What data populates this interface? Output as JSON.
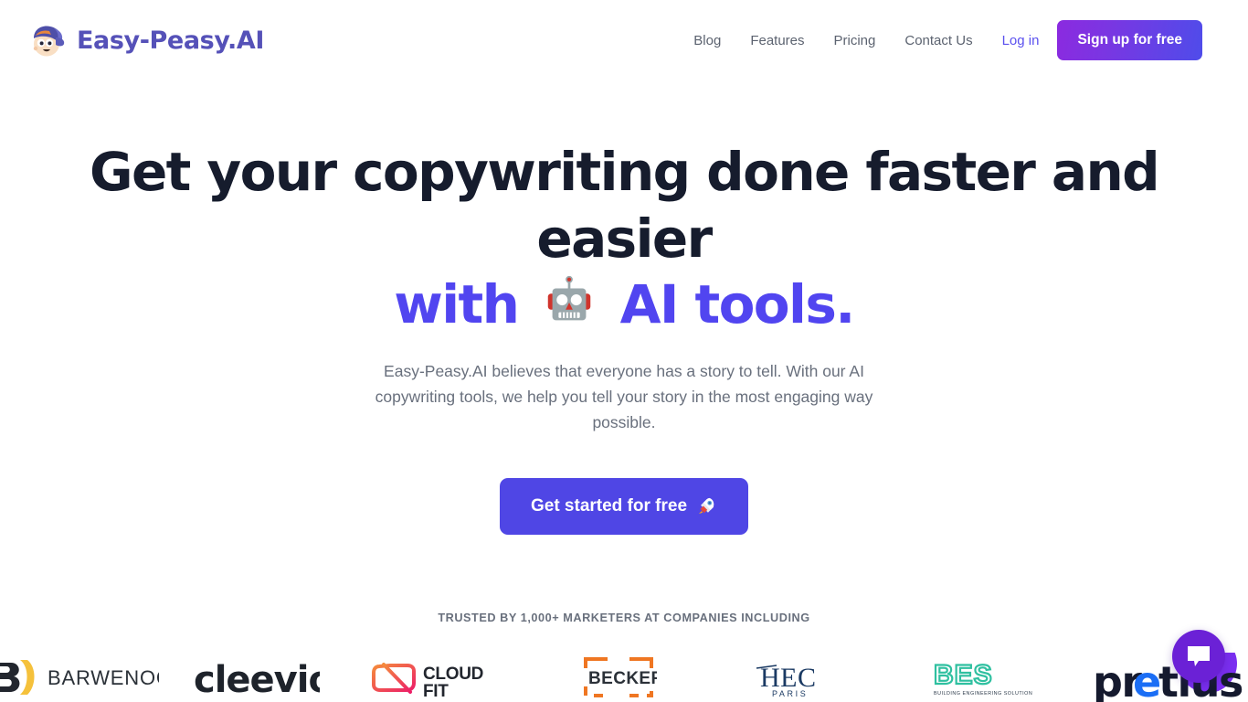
{
  "brand": {
    "name": "Easy-Peasy.AI",
    "logo_icon": "mascot-face-icon",
    "color": "#5551b8"
  },
  "nav": {
    "links": [
      {
        "label": "Blog",
        "name": "nav-link-blog"
      },
      {
        "label": "Features",
        "name": "nav-link-features"
      },
      {
        "label": "Pricing",
        "name": "nav-link-pricing"
      },
      {
        "label": "Contact Us",
        "name": "nav-link-contact-us"
      }
    ],
    "login_label": "Log in",
    "signup_label": "Sign up for free",
    "login_color": "#5b51ef",
    "signup_gradient_from": "#8b2ae0",
    "signup_gradient_to": "#4f4cea"
  },
  "hero": {
    "headline_line1": "Get your copywriting done faster and easier",
    "headline_line2_prefix": "with",
    "headline_emoji": "robot-emoji",
    "headline_line2_suffix": "AI tools.",
    "headline_color": "#161c2d",
    "accent_color": "#5145f0",
    "subheading": "Easy-Peasy.AI believes that everyone has a story to tell. With our AI copywriting tools, we help you tell your story in the most engaging way possible.",
    "cta_label": "Get started for free",
    "cta_emoji": "rocket-emoji",
    "cta_color": "#4f46e5"
  },
  "trusted": {
    "text": "TRUSTED BY 1,000+ MARKETERS AT COMPANIES INCLUDING"
  },
  "logos": [
    {
      "name": "logo-barwenock",
      "label": "BARWENOCK"
    },
    {
      "name": "logo-cleevio",
      "label": "cleevio"
    },
    {
      "name": "logo-cloudfit",
      "label": "CLOUD FIT"
    },
    {
      "name": "logo-becker",
      "label": "BECKER"
    },
    {
      "name": "logo-hec-paris",
      "label": "HEC PARIS"
    },
    {
      "name": "logo-bes",
      "label": "BES",
      "tagline": "BUILDING ENGINEERING SOLUTIONS"
    },
    {
      "name": "logo-pretius",
      "label": "pretius"
    }
  ],
  "chat": {
    "icon": "chat-bubble-icon",
    "color": "#6b21d6"
  }
}
